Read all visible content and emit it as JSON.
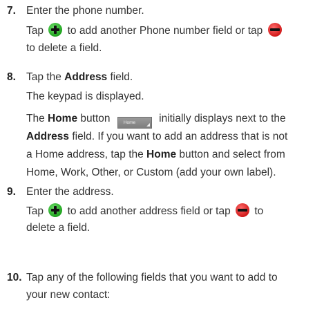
{
  "steps": [
    {
      "number": "7.",
      "lines": [
        {
          "text": "Enter the phone number."
        },
        {
          "before": "Tap ",
          "middle": " to add another Phone number field or tap ",
          "after": ""
        },
        {
          "text": "to delete a field."
        }
      ]
    },
    {
      "number": "8.",
      "lines": [
        {
          "before": "Tap the ",
          "bold": "Address",
          "after": " field."
        },
        {
          "text": "The keypad is displayed."
        },
        {
          "before": "The ",
          "bold": "Home",
          "middle": " button ",
          "button_label": "Home",
          "after": " initially displays next to the"
        },
        {
          "bold": "Address",
          "after": " field. If you want to add an address that is not"
        },
        {
          "before": "a Home address, tap the ",
          "bold": "Home",
          "after": " button and select from"
        },
        {
          "text": "Home, Work, Other, or Custom (add your own label)."
        }
      ]
    },
    {
      "number": "9.",
      "lines": [
        {
          "text": "Enter the address."
        },
        {
          "before": "Tap ",
          "middle": " to add another address field or tap ",
          "after": " to"
        },
        {
          "text": "delete a field."
        }
      ]
    },
    {
      "number": "10.",
      "lines": [
        {
          "text": "Tap any of the following fields that you want to add to"
        },
        {
          "text": "your new contact:"
        }
      ]
    }
  ],
  "icons": {
    "add": "plus-circle-icon",
    "delete": "minus-circle-icon",
    "add_color": "#1fa31f",
    "delete_color": "#d11a1a"
  }
}
